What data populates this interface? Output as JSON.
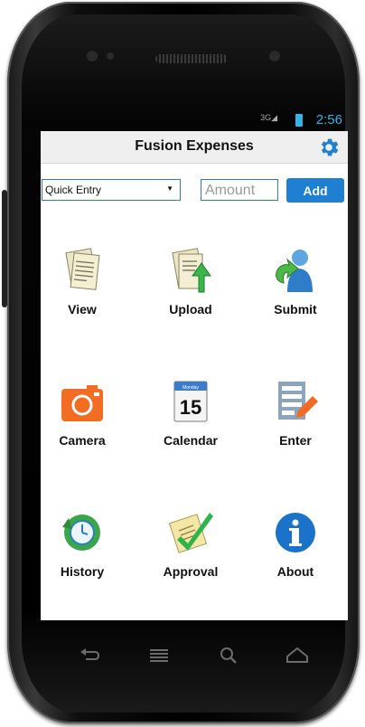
{
  "status_bar": {
    "network": "3G",
    "time": "2:56"
  },
  "app": {
    "title": "Fusion Expenses"
  },
  "entry": {
    "selected_option": "Quick Entry",
    "amount_placeholder": "Amount",
    "add_label": "Add"
  },
  "grid": {
    "view": "View",
    "upload": "Upload",
    "submit": "Submit",
    "camera": "Camera",
    "calendar": "Calendar",
    "calendar_month": "Monday",
    "calendar_day": "15",
    "enter": "Enter",
    "history": "History",
    "approval": "Approval",
    "about": "About"
  },
  "colors": {
    "accent": "#1f7fd0",
    "status": "#33b5e5"
  }
}
